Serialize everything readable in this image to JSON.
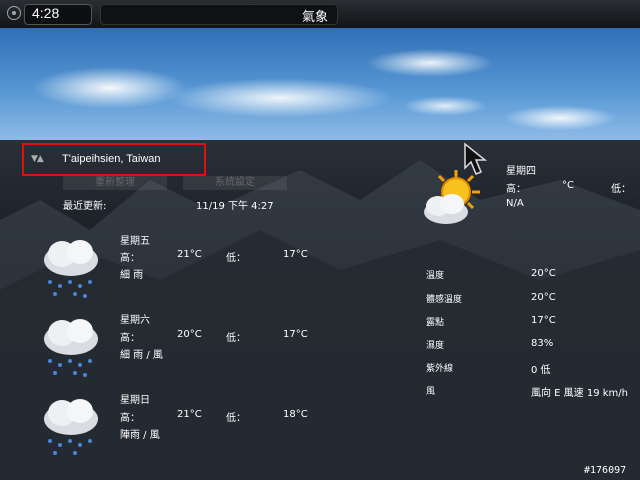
{
  "topbar": {
    "time": "4:28",
    "title": "氣象"
  },
  "location": "T'aipeihsien, Taiwan",
  "buttons": {
    "refresh": "重新整理",
    "settings": "系統設定"
  },
  "last_updated": {
    "label": "最近更新:",
    "value": "11/19 下午 4:27"
  },
  "forecast": [
    {
      "day": "星期五",
      "high_label": "高：",
      "high": "21°C",
      "low_label": "低：",
      "low": "17°C",
      "condition": "細 雨",
      "icon": "rain-cloud-icon"
    },
    {
      "day": "星期六",
      "high_label": "高：",
      "high": "20°C",
      "low_label": "低：",
      "low": "17°C",
      "condition": "細 雨 / 風",
      "icon": "rain-cloud-icon"
    },
    {
      "day": "星期日",
      "high_label": "高：",
      "high": "21°C",
      "low_label": "低：",
      "low": "18°C",
      "condition": "陣雨 / 風",
      "icon": "rain-cloud-icon"
    }
  ],
  "today": {
    "day": "星期四",
    "high_label": "高：",
    "high_unit": "°C",
    "low_label": "低：",
    "condition": "N/A",
    "icon": "sun-cloud-icon"
  },
  "details": [
    {
      "label": "溫度",
      "value": "20°C"
    },
    {
      "label": "體感溫度",
      "value": "20°C"
    },
    {
      "label": "露點",
      "value": "17°C"
    },
    {
      "label": "濕度",
      "value": "83%"
    },
    {
      "label": "紫外線",
      "value": "0 低"
    },
    {
      "label": "風",
      "value": "風向 E 風速 19 km/h"
    }
  ],
  "watermark": "#176097"
}
